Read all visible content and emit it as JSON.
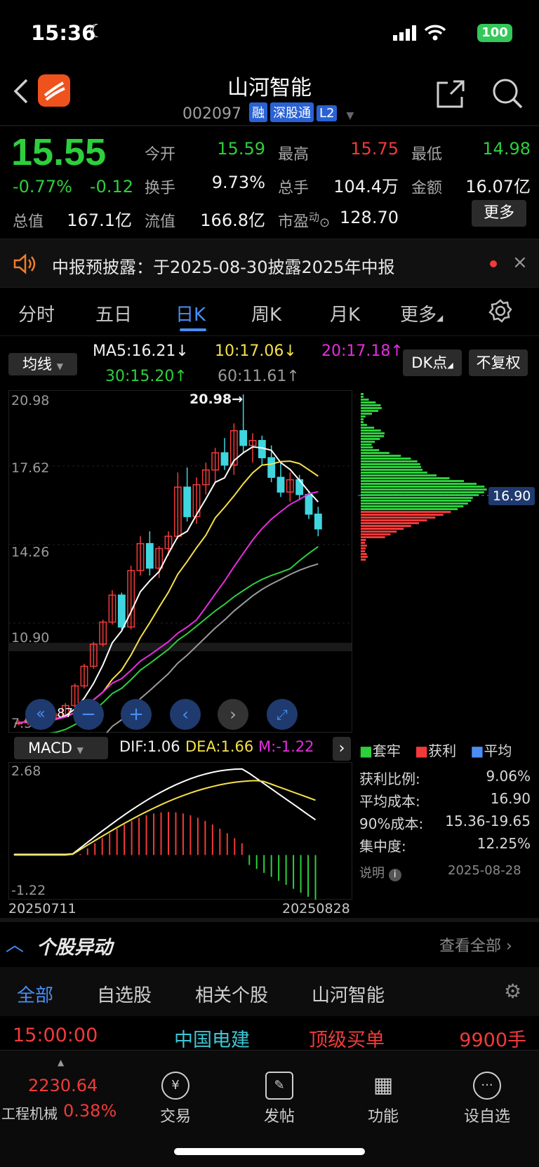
{
  "status": {
    "time": "15:36",
    "battery": "100"
  },
  "header": {
    "title": "山河智能",
    "code": "002097",
    "tags": [
      "融",
      "深股通",
      "L2"
    ]
  },
  "quote": {
    "price": "15.55",
    "change_pct": "-0.77%",
    "change": "-0.12",
    "open_label": "今开",
    "open": "15.59",
    "high_label": "最高",
    "high": "15.75",
    "low_label": "最低",
    "low": "14.98",
    "turnover_label": "换手",
    "turnover": "9.73%",
    "volume_label": "总手",
    "volume": "104.4万",
    "amount_label": "金额",
    "amount": "16.07亿",
    "mktcap_label": "总值",
    "mktcap": "167.1亿",
    "float_label": "流值",
    "float": "166.8亿",
    "pe_label": "市盈",
    "pe_sup": "动",
    "pe": "128.70",
    "more_button": "更多"
  },
  "notice": {
    "text": "中报预披露：于2025-08-30披露2025年中报"
  },
  "kline_tabs": [
    "分时",
    "五日",
    "日K",
    "周K",
    "月K",
    "更多"
  ],
  "active_tab": "日K",
  "ma_legend": {
    "selector": "均线",
    "ma5": "MA5:16.21↓",
    "ma10": "10:17.06↓",
    "ma20": "20:17.18↑",
    "ma30": "30:15.20↑",
    "ma60": "60:11.61↑",
    "dk_button": "DK点",
    "fq_button": "不复权"
  },
  "price_axis": {
    "labels": [
      "20.98",
      "17.62",
      "14.26",
      "10.90",
      "7.54"
    ],
    "high_marker": "20.98→",
    "low_marker": "7.87",
    "cost_marker": "16.90"
  },
  "macd": {
    "selector": "MACD",
    "dif": "DIF:1.06",
    "dea": "DEA:1.66",
    "m": "M:-1.22",
    "top": "2.68",
    "bottom": "-1.22"
  },
  "dates": {
    "start": "20250711",
    "end": "20250828"
  },
  "chip_legend": [
    "套牢",
    "获利",
    "平均"
  ],
  "chip_stats": [
    {
      "label": "获利比例:",
      "value": "9.06%"
    },
    {
      "label": "平均成本:",
      "value": "16.90"
    },
    {
      "label": "90%成本:",
      "value": "15.36-19.65"
    },
    {
      "label": "集中度:",
      "value": "12.25%"
    }
  ],
  "chip_note": {
    "label": "说明",
    "date": "2025-08-28"
  },
  "stock_movement": {
    "title": "个股异动",
    "view_all": "查看全部"
  },
  "movement_tabs": [
    "全部",
    "自选股",
    "相关个股",
    "山河智能"
  ],
  "movement_row": {
    "time": "15:00:00",
    "stock": "中国电建",
    "type": "顶级买单",
    "amount": "9900手"
  },
  "index_ticker": {
    "value": "2230.64",
    "name": "工程机械",
    "pct": "0.38%"
  },
  "bottom_nav": [
    "交易",
    "发帖",
    "功能",
    "设自选"
  ],
  "colors": {
    "up": "#f23a3a",
    "down": "#2dcf3d",
    "accent": "#4a8ef5"
  },
  "chart_data": {
    "type": "candlestick",
    "x": [
      "20250711",
      "20250828"
    ],
    "ohlc_approx": [
      [
        7.6,
        7.7,
        7.5,
        7.6
      ],
      [
        7.6,
        7.7,
        7.5,
        7.7
      ],
      [
        7.7,
        7.8,
        7.6,
        7.7
      ],
      [
        7.7,
        7.9,
        7.6,
        7.8
      ],
      [
        7.8,
        8.0,
        7.7,
        7.9
      ],
      [
        7.9,
        8.4,
        7.9,
        8.3
      ],
      [
        8.3,
        9.2,
        8.2,
        9.1
      ],
      [
        9.1,
        10.0,
        9.0,
        9.9
      ],
      [
        9.9,
        10.9,
        9.8,
        10.8
      ],
      [
        10.8,
        11.8,
        10.7,
        11.7
      ],
      [
        11.7,
        13.0,
        11.6,
        12.8
      ],
      [
        12.8,
        12.9,
        11.4,
        11.5
      ],
      [
        11.5,
        14.0,
        11.4,
        13.8
      ],
      [
        13.8,
        15.2,
        13.6,
        14.9
      ],
      [
        14.9,
        15.4,
        13.6,
        13.9
      ],
      [
        13.9,
        14.8,
        13.5,
        14.7
      ],
      [
        14.7,
        15.4,
        14.4,
        15.2
      ],
      [
        15.2,
        17.8,
        15.1,
        17.2
      ],
      [
        17.2,
        18.0,
        15.8,
        16.0
      ],
      [
        16.0,
        17.6,
        15.7,
        17.3
      ],
      [
        17.3,
        18.2,
        16.9,
        17.9
      ],
      [
        17.9,
        18.8,
        17.4,
        18.6
      ],
      [
        18.6,
        19.2,
        17.9,
        18.1
      ],
      [
        18.1,
        19.8,
        17.7,
        19.5
      ],
      [
        19.5,
        20.98,
        18.6,
        18.9
      ],
      [
        18.9,
        19.4,
        18.2,
        19.1
      ],
      [
        19.1,
        19.3,
        18.1,
        18.4
      ],
      [
        18.4,
        18.9,
        17.4,
        17.6
      ],
      [
        17.6,
        18.2,
        16.8,
        17.0
      ],
      [
        17.0,
        17.8,
        16.6,
        17.5
      ],
      [
        17.5,
        17.7,
        16.7,
        16.9
      ],
      [
        16.9,
        17.0,
        15.9,
        16.1
      ],
      [
        16.1,
        16.4,
        15.2,
        15.5
      ]
    ],
    "ma_series": [
      "MA5",
      "MA10",
      "MA20",
      "MA30",
      "MA60"
    ],
    "macd_range": [
      -1.22,
      2.68
    ]
  }
}
